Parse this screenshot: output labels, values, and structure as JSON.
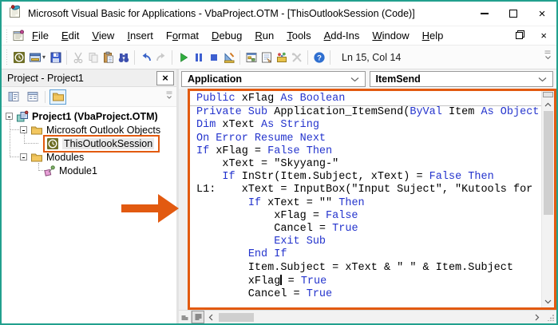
{
  "colors": {
    "accent_orange": "#e25a10",
    "frame_teal": "#22a08e",
    "keyword_blue": "#2434cd"
  },
  "titlebar": {
    "title": "Microsoft Visual Basic for Applications - VbaProject.OTM - [ThisOutlookSession (Code)]",
    "close_glyph": "×"
  },
  "menubar": {
    "items": [
      {
        "label": "File",
        "u": 0
      },
      {
        "label": "Edit",
        "u": 0
      },
      {
        "label": "View",
        "u": 0
      },
      {
        "label": "Insert",
        "u": 0
      },
      {
        "label": "Format",
        "u": 1
      },
      {
        "label": "Debug",
        "u": 0
      },
      {
        "label": "Run",
        "u": 0
      },
      {
        "label": "Tools",
        "u": 0
      },
      {
        "label": "Add-Ins",
        "u": 0
      },
      {
        "label": "Window",
        "u": 0
      },
      {
        "label": "Help",
        "u": 0
      }
    ],
    "mdi_close_glyph": "×"
  },
  "toolbar": {
    "position_label": "Ln 15, Col 14",
    "buttons": [
      {
        "name": "view-outlook-button",
        "icon": "view-outlook-icon"
      },
      {
        "name": "insert-userform-button",
        "icon": "insert-userform-icon",
        "dropdown": true
      },
      {
        "name": "save-button",
        "icon": "save-icon"
      },
      {
        "sep": true
      },
      {
        "name": "cut-button",
        "icon": "cut-icon",
        "disabled": true
      },
      {
        "name": "copy-button",
        "icon": "copy-icon",
        "disabled": true
      },
      {
        "name": "paste-button",
        "icon": "paste-icon"
      },
      {
        "name": "find-button",
        "icon": "find-icon"
      },
      {
        "sep": true
      },
      {
        "name": "undo-button",
        "icon": "undo-icon"
      },
      {
        "name": "redo-button",
        "icon": "redo-icon",
        "disabled": true
      },
      {
        "sep": true
      },
      {
        "name": "run-button",
        "icon": "run-icon"
      },
      {
        "name": "break-button",
        "icon": "break-icon"
      },
      {
        "name": "reset-button",
        "icon": "reset-icon"
      },
      {
        "name": "design-mode-button",
        "icon": "design-mode-icon"
      },
      {
        "sep": true
      },
      {
        "name": "project-explorer-button",
        "icon": "project-explorer-icon"
      },
      {
        "name": "properties-window-button",
        "icon": "properties-window-icon"
      },
      {
        "name": "object-browser-button",
        "icon": "object-browser-icon"
      },
      {
        "name": "toolbox-button",
        "icon": "toolbox-icon",
        "disabled": true
      },
      {
        "sep": true
      },
      {
        "name": "help-button",
        "icon": "help-icon"
      }
    ]
  },
  "project_panel": {
    "caption": "Project - Project1",
    "close_glyph": "×",
    "tree": {
      "root": "Project1 (VbaProject.OTM)",
      "outlook_objects": "Microsoft Outlook Objects",
      "session": "ThisOutlookSession",
      "modules": "Modules",
      "module1": "Module1"
    }
  },
  "code_window": {
    "object_dropdown": "Application",
    "event_dropdown": "ItemSend",
    "separator_after_line": 1,
    "code_lines": [
      [
        [
          "k",
          "Public "
        ],
        [
          "n",
          "xFlag "
        ],
        [
          "k",
          "As Boolean"
        ]
      ],
      [
        [
          "k",
          "Private Sub "
        ],
        [
          "n",
          "Application_ItemSend("
        ],
        [
          "k",
          "ByVal "
        ],
        [
          "n",
          "Item "
        ],
        [
          "k",
          "As Object"
        ]
      ],
      [
        [
          "k",
          "Dim "
        ],
        [
          "n",
          "xText "
        ],
        [
          "k",
          "As String"
        ]
      ],
      [
        [
          "k",
          "On Error Resume Next"
        ]
      ],
      [
        [
          "k",
          "If "
        ],
        [
          "n",
          "xFlag = "
        ],
        [
          "k",
          "False Then"
        ]
      ],
      [
        [
          "n",
          "    xText = \"Skyyang-\""
        ]
      ],
      [
        [
          "n",
          "    "
        ],
        [
          "k",
          "If "
        ],
        [
          "n",
          "InStr(Item.Subject, xText) = "
        ],
        [
          "k",
          "False Then"
        ]
      ],
      [
        [
          "n",
          "L1:    xText = InputBox(\"Input Suject\", \"Kutools for"
        ]
      ],
      [
        [
          "n",
          "        "
        ],
        [
          "k",
          "If "
        ],
        [
          "n",
          "xText = \"\" "
        ],
        [
          "k",
          "Then"
        ]
      ],
      [
        [
          "n",
          "            xFlag = "
        ],
        [
          "k",
          "False"
        ]
      ],
      [
        [
          "n",
          "            Cancel = "
        ],
        [
          "k",
          "True"
        ]
      ],
      [
        [
          "n",
          "            "
        ],
        [
          "k",
          "Exit Sub"
        ]
      ],
      [
        [
          "n",
          "        "
        ],
        [
          "k",
          "End If"
        ]
      ],
      [
        [
          "n",
          "        Item.Subject = xText & \" \" & Item.Subject"
        ]
      ],
      [
        [
          "n",
          "        xFlag"
        ],
        [
          "c",
          ""
        ],
        [
          "n",
          " = "
        ],
        [
          "k",
          "True"
        ]
      ],
      [
        [
          "n",
          "        Cancel = "
        ],
        [
          "k",
          "True"
        ]
      ]
    ]
  }
}
